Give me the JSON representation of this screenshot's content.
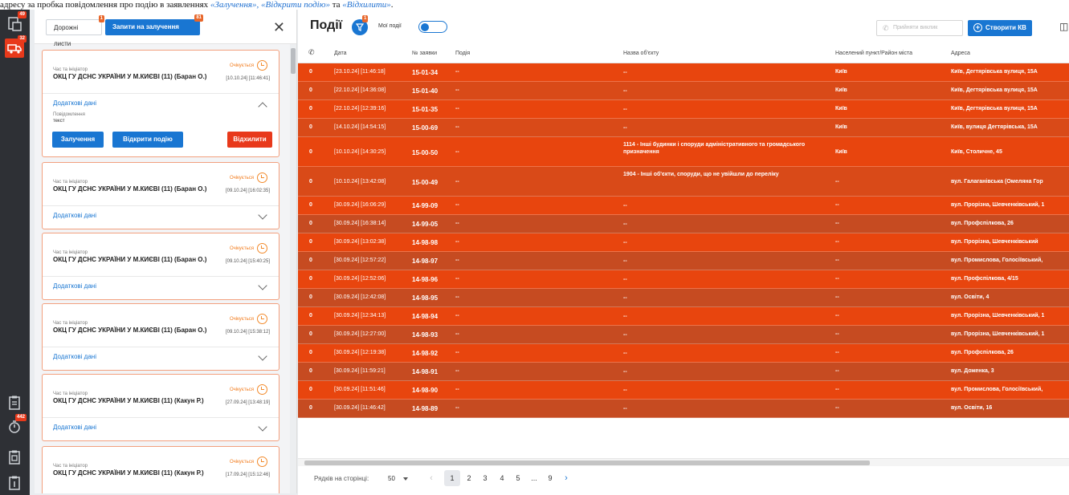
{
  "topline": {
    "prefix": "адресу за пробка повідомлення про подію в заявленнях",
    "quote1": "«Залучення»,",
    "quote2": "«Відкрити подію»",
    "mid": "та",
    "quote3": "«Відхилити»",
    "end": "."
  },
  "rail": {
    "badge_top": "49",
    "badge_second": "32",
    "badge_bottom": "442"
  },
  "requests": {
    "tab_waybills": "Дорожні листи",
    "tab_waybills_badge": "1",
    "tab_requests": "Запити на залучення",
    "tab_requests_badge": "81",
    "close": "✕",
    "initiator_label": "Час та ініціатор",
    "status": "Очікується",
    "more_label": "Додаткові дані",
    "note_label": "Повідомлення",
    "note_text": "текст",
    "btn_engage": "Залучення",
    "btn_open_event": "Відкрити подію",
    "btn_reject": "Відхилити",
    "cards": [
      {
        "org": "ОКЦ ГУ ДСНС УКРАЇНИ У М.КИЄВІ (11) (Баран О.)",
        "time": "[10.10.24] [11:46:41]",
        "expanded": true
      },
      {
        "org": "ОКЦ ГУ ДСНС УКРАЇНИ У М.КИЄВІ (11) (Баран О.)",
        "time": "[09.10.24] [16:02:35]",
        "expanded": false
      },
      {
        "org": "ОКЦ ГУ ДСНС УКРАЇНИ У М.КИЄВІ (11) (Баран О.)",
        "time": "[09.10.24] [15:40:25]",
        "expanded": false
      },
      {
        "org": "ОКЦ ГУ ДСНС УКРАЇНИ У М.КИЄВІ (11) (Баран О.)",
        "time": "[09.10.24] [15:38:12]",
        "expanded": false
      },
      {
        "org": "ОКЦ ГУ ДСНС УКРАЇНИ У М.КИЄВІ (11) (Какун Р.)",
        "time": "[27.09.24] [13:48:19]",
        "expanded": false
      },
      {
        "org": "ОКЦ ГУ ДСНС УКРАЇНИ У М.КИЄВІ (11) (Какун Р.)",
        "time": "[17.09.24] [15:12:46]",
        "expanded": false
      }
    ]
  },
  "events": {
    "title": "Події",
    "filter_badge": "1",
    "my_events": "Мої події",
    "accept_call": "Прийняти виклик",
    "create_kv": "Створити КВ",
    "columns": [
      "Дата",
      "№ заявки",
      "Подія",
      "Назва об'єкту",
      "Населений пункт/Район міста",
      "Адреса"
    ],
    "rows": [
      {
        "n": "0",
        "date": "[23.10.24] [11:46:18]",
        "id": "15-01-34",
        "event": "--",
        "name": "--",
        "city": "Київ",
        "addr": "Київ, Дегтярівська вулиця, 15А"
      },
      {
        "n": "0",
        "date": "[22.10.24] [14:36:08]",
        "id": "15-01-40",
        "event": "--",
        "name": "--",
        "city": "Київ",
        "addr": "Київ, Дегтярівська вулиця, 15А"
      },
      {
        "n": "0",
        "date": "[22.10.24] [12:39:16]",
        "id": "15-01-35",
        "event": "--",
        "name": "--",
        "city": "Київ",
        "addr": "Київ, Дегтярівська вулиця, 15А"
      },
      {
        "n": "0",
        "date": "[14.10.24] [14:54:15]",
        "id": "15-00-69",
        "event": "--",
        "name": "--",
        "city": "Київ",
        "addr": "Київ, вулиця Дегтярівська, 15А"
      },
      {
        "n": "0",
        "date": "[10.10.24] [14:30:25]",
        "id": "15-00-50",
        "event": "--",
        "name": "1114 - Інші будинки і споруди адміністративного та громадського призначення",
        "city": "Київ",
        "addr": "Київ, Столичне, 45"
      },
      {
        "n": "0",
        "date": "[10.10.24] [13:42:08]",
        "id": "15-00-49",
        "event": "--",
        "name": "1904 - Інші об'єкти, споруди, що не увійшли до переліку",
        "city": "--",
        "addr": "вул. Галаганівська (Омеляна Гор"
      },
      {
        "n": "0",
        "date": "[30.09.24] [16:06:29]",
        "id": "14-99-09",
        "event": "--",
        "name": "--",
        "city": "--",
        "addr": "вул. Прорізна, Шевченківський, 1"
      },
      {
        "n": "0",
        "date": "[30.09.24] [16:38:14]",
        "id": "14-99-05",
        "event": "--",
        "name": "--",
        "city": "--",
        "addr": "вул. Профспілкова, 26"
      },
      {
        "n": "0",
        "date": "[30.09.24] [13:02:38]",
        "id": "14-98-98",
        "event": "--",
        "name": "--",
        "city": "--",
        "addr": "вул. Прорізна, Шевченківський"
      },
      {
        "n": "0",
        "date": "[30.09.24] [12:57:22]",
        "id": "14-98-97",
        "event": "--",
        "name": "--",
        "city": "--",
        "addr": "вул. Промислова, Голосіївський,"
      },
      {
        "n": "0",
        "date": "[30.09.24] [12:52:06]",
        "id": "14-98-96",
        "event": "--",
        "name": "--",
        "city": "--",
        "addr": "вул. Профспілкова, 4/15"
      },
      {
        "n": "0",
        "date": "[30.09.24] [12:42:08]",
        "id": "14-98-95",
        "event": "--",
        "name": "--",
        "city": "--",
        "addr": "вул. Освіти, 4"
      },
      {
        "n": "0",
        "date": "[30.09.24] [12:34:13]",
        "id": "14-98-94",
        "event": "--",
        "name": "--",
        "city": "--",
        "addr": "вул. Прорізна, Шевченківський, 1"
      },
      {
        "n": "0",
        "date": "[30.09.24] [12:27:00]",
        "id": "14-98-93",
        "event": "--",
        "name": "--",
        "city": "--",
        "addr": "вул. Прорізна, Шевченківський, 1"
      },
      {
        "n": "0",
        "date": "[30.09.24] [12:19:38]",
        "id": "14-98-92",
        "event": "--",
        "name": "--",
        "city": "--",
        "addr": "вул. Профспілкова, 26"
      },
      {
        "n": "0",
        "date": "[30.09.24] [11:59:21]",
        "id": "14-98-91",
        "event": "--",
        "name": "--",
        "city": "--",
        "addr": "вул. Доженка, 3"
      },
      {
        "n": "0",
        "date": "[30.09.24] [11:51:46]",
        "id": "14-98-90",
        "event": "--",
        "name": "--",
        "city": "--",
        "addr": "вул. Промислова, Голосіївський,"
      },
      {
        "n": "0",
        "date": "[30.09.24] [11:46:42]",
        "id": "14-98-89",
        "event": "--",
        "name": "--",
        "city": "--",
        "addr": "вул. Освіти, 16"
      }
    ],
    "pager": {
      "rows_per_page_label": "Рядків на сторінці:",
      "rows_per_page": "50",
      "pages": [
        "1",
        "2",
        "3",
        "4",
        "5",
        "...",
        "9"
      ],
      "current": "1"
    }
  },
  "colors": {
    "accent": "#1976d2",
    "row_primary": "#e8450e",
    "row_alt": "#c64b21",
    "danger": "#e8391b"
  }
}
